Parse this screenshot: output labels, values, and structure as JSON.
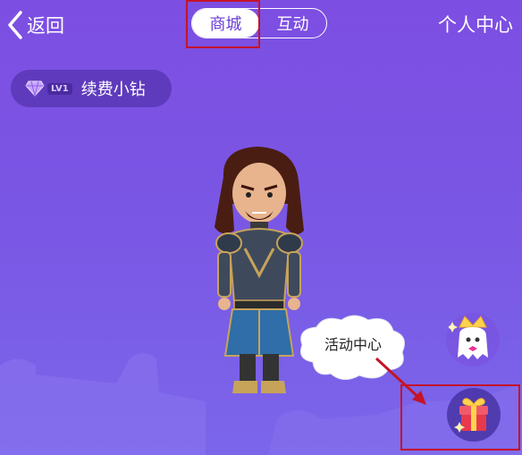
{
  "header": {
    "back_label": "返回",
    "tabs": [
      {
        "label": "商城",
        "active": true
      },
      {
        "label": "互动",
        "active": false
      }
    ],
    "personal_center": "个人中心"
  },
  "membership": {
    "level_badge": "LV1",
    "renew_label": "续费小钻",
    "gem_icon": "diamond-icon"
  },
  "callout": {
    "text": "活动中心"
  },
  "floating_buttons": [
    {
      "icon": "ghost-crown-icon"
    },
    {
      "icon": "gift-icon"
    }
  ],
  "colors": {
    "background_top": "#7d4ee2",
    "background_bottom": "#7b66ea",
    "annotation_red": "#c4142a",
    "gift_red": "#e8394c"
  }
}
